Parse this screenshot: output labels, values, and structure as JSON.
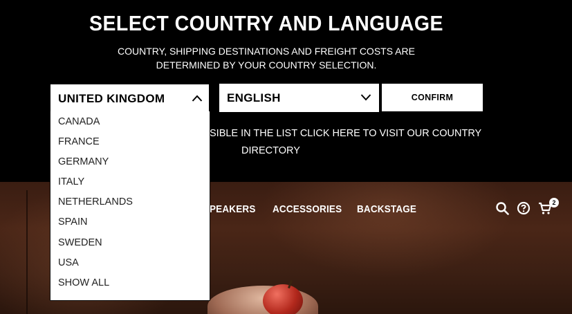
{
  "modal": {
    "title": "SELECT COUNTRY AND LANGUAGE",
    "subtitle_line1": "COUNTRY, SHIPPING DESTINATIONS AND FREIGHT COSTS ARE",
    "subtitle_line2": "DETERMINED BY YOUR COUNTRY SELECTION.",
    "notice_line1": "SIBLE IN THE LIST CLICK HERE TO VISIT OUR COUNTRY",
    "notice_line2": "DIRECTORY",
    "country_select": {
      "value": "UNITED KINGDOM",
      "icon": "chevron-up-icon",
      "expanded": true
    },
    "language_select": {
      "value": "ENGLISH",
      "icon": "chevron-down-icon"
    },
    "confirm_label": "CONFIRM",
    "country_options": [
      "CANADA",
      "FRANCE",
      "GERMANY",
      "ITALY",
      "NETHERLANDS",
      "SPAIN",
      "SWEDEN",
      "USA",
      "SHOW ALL"
    ]
  },
  "nav": {
    "items": [
      "PEAKERS",
      "ACCESSORIES",
      "BACKSTAGE"
    ],
    "icons": [
      "search-icon",
      "help-icon",
      "cart-icon"
    ],
    "cart_count": "2"
  }
}
